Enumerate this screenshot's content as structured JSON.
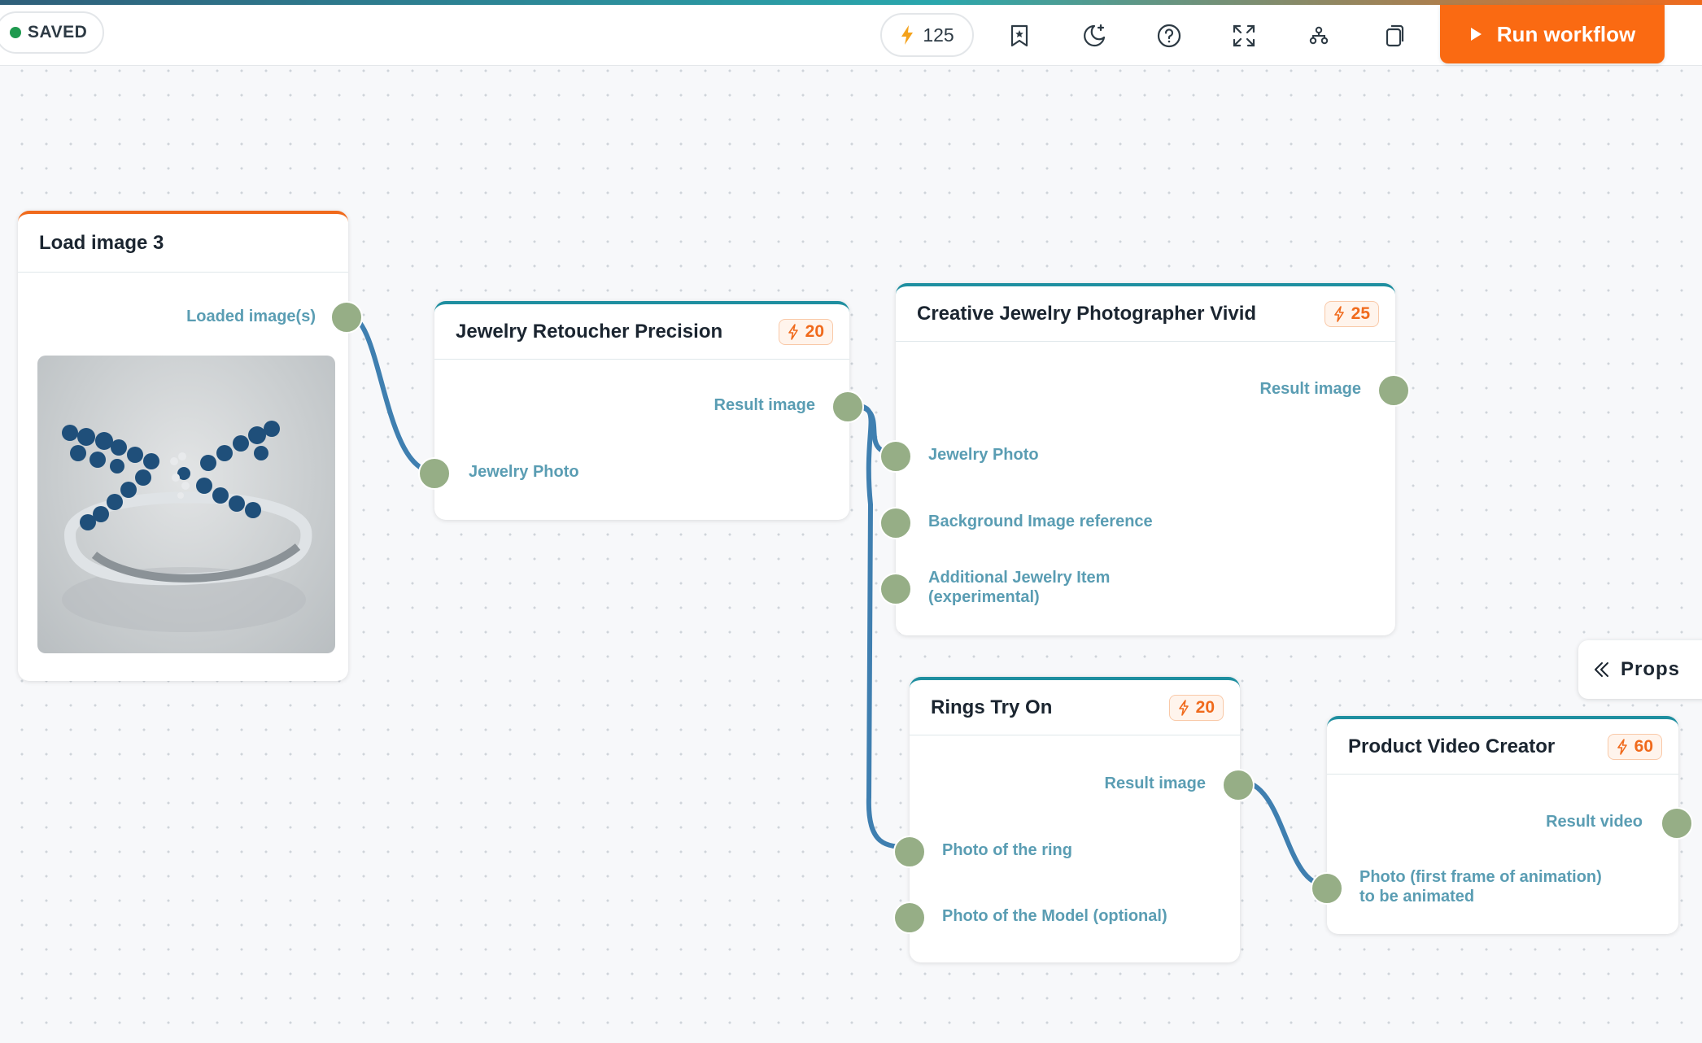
{
  "topbar": {
    "saved_label": "SAVED",
    "credits": "125",
    "run_label": "Run workflow",
    "icons": [
      "bolt-icon",
      "bookmark-star-icon",
      "moon-sparkle-icon",
      "help-icon",
      "fullscreen-icon",
      "layout-tree-icon",
      "copy-icon",
      "play-icon"
    ],
    "accent_color": "#fa6a12"
  },
  "nodes": {
    "load_image": {
      "title": "Load image 3",
      "outputs": [
        "Loaded image(s)"
      ]
    },
    "retoucher": {
      "title": "Jewelry Retoucher Precision",
      "cost": "20",
      "outputs": [
        "Result image"
      ],
      "inputs": [
        "Jewelry Photo"
      ]
    },
    "photographer": {
      "title": "Creative Jewelry Photographer Vivid",
      "cost": "25",
      "outputs": [
        "Result image"
      ],
      "inputs": [
        "Jewelry Photo",
        "Background Image reference",
        "Additional Jewelry Item (experimental)"
      ]
    },
    "rings": {
      "title": "Rings Try On",
      "cost": "20",
      "outputs": [
        "Result image"
      ],
      "inputs": [
        "Photo of the ring",
        "Photo of the Model (optional)"
      ]
    },
    "video": {
      "title": "Product Video Creator",
      "cost": "60",
      "outputs": [
        "Result video"
      ],
      "inputs": [
        "Photo (first frame of animation) to be animated"
      ]
    }
  },
  "props_label": "Props",
  "colors": {
    "node_border": "#1f8fa0",
    "load_node_border": "#f06a1c",
    "wire": "#3f7fb0",
    "handle": "#96ae86",
    "port_label": "#5a9db3",
    "badge_text": "#f06a1c"
  }
}
